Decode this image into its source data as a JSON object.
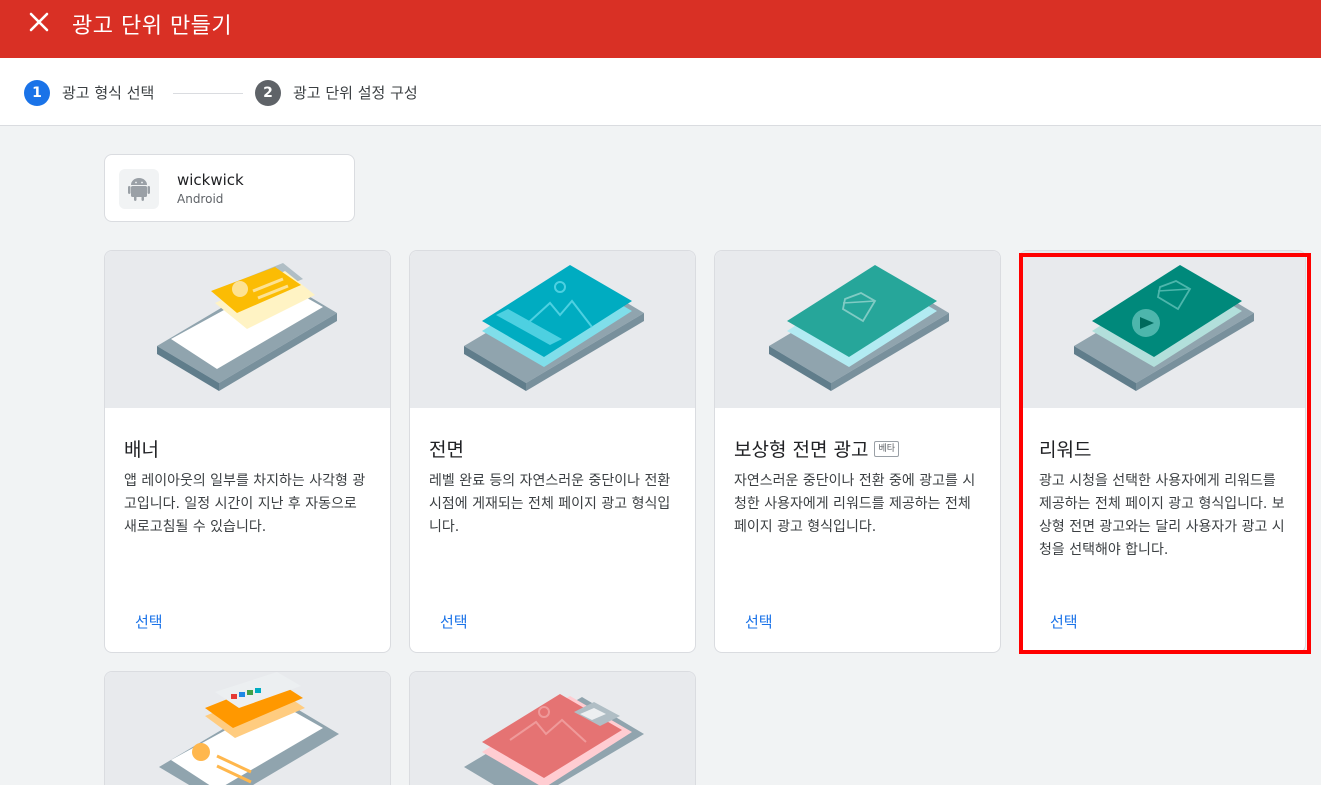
{
  "header": {
    "title": "광고 단위 만들기"
  },
  "stepper": {
    "steps": [
      {
        "number": "1",
        "label": "광고 형식 선택"
      },
      {
        "number": "2",
        "label": "광고 단위 설정 구성"
      }
    ]
  },
  "app": {
    "name": "wickwick",
    "platform": "Android"
  },
  "formats": [
    {
      "title": "배너",
      "badge": "",
      "description": "앱 레이아웃의 일부를 차지하는 사각형 광고입니다. 일정 시간이 지난 후 자동으로 새로고침될 수 있습니다.",
      "select_label": "선택"
    },
    {
      "title": "전면",
      "badge": "",
      "description": "레벨 완료 등의 자연스러운 중단이나 전환 시점에 게재되는 전체 페이지 광고 형식입니다.",
      "select_label": "선택"
    },
    {
      "title": "보상형 전면 광고",
      "badge": "베타",
      "description": "자연스러운 중단이나 전환 중에 광고를 시청한 사용자에게 리워드를 제공하는 전체 페이지 광고 형식입니다.",
      "select_label": "선택"
    },
    {
      "title": "리워드",
      "badge": "",
      "description": "광고 시청을 선택한 사용자에게 리워드를 제공하는 전체 페이지 광고 형식입니다. 보상형 전면 광고와는 달리 사용자가 광고 시청을 선택해야 합니다.",
      "select_label": "선택"
    }
  ],
  "colors": {
    "header_bg": "#d93025",
    "accent_blue": "#1a73e8",
    "highlight": "#ff0000",
    "banner_yellow": "#fbbc04",
    "interstitial_cyan": "#00acc1",
    "rewarded_interstitial_teal": "#26a69a",
    "rewarded_green": "#00897b",
    "native_orange": "#ff9800",
    "coral": "#e57373"
  }
}
